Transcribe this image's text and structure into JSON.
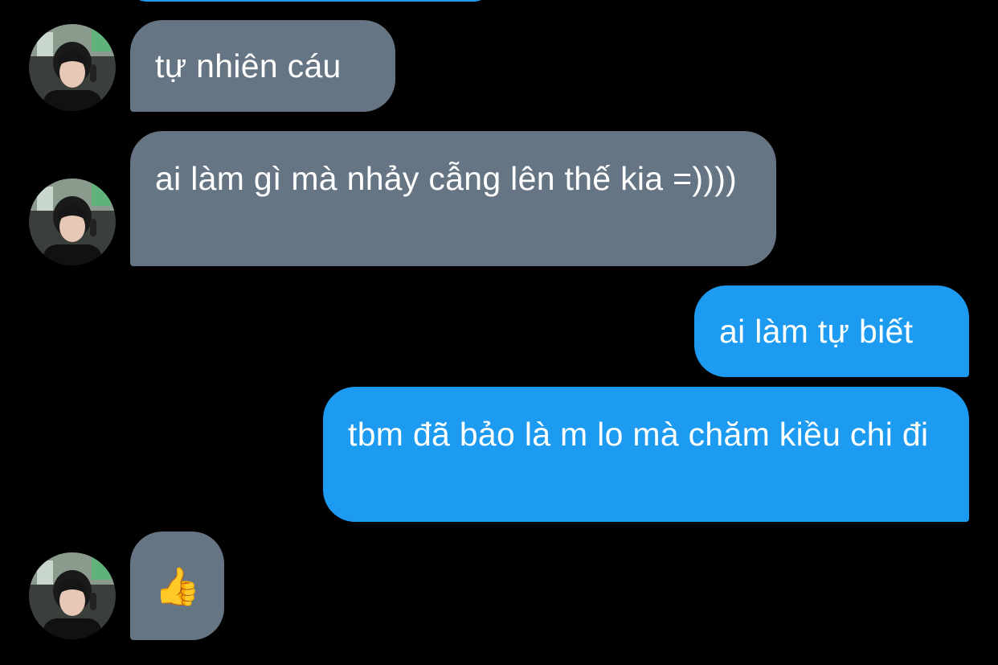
{
  "colors": {
    "background": "#000000",
    "received_bubble": "#667583",
    "sent_bubble": "#1d9bf0",
    "text": "#ffffff"
  },
  "messages": [
    {
      "direction": "received",
      "text": "tự nhiên cáu"
    },
    {
      "direction": "received",
      "text": "ai làm gì mà nhảy cẫng lên thế kia =))))"
    },
    {
      "direction": "sent",
      "text": "ai làm tự biết"
    },
    {
      "direction": "sent",
      "text": "tbm đã bảo là m lo mà chăm kiều chi đi"
    },
    {
      "direction": "received",
      "text": "👍",
      "icon": "thumbs-up-icon"
    }
  ]
}
